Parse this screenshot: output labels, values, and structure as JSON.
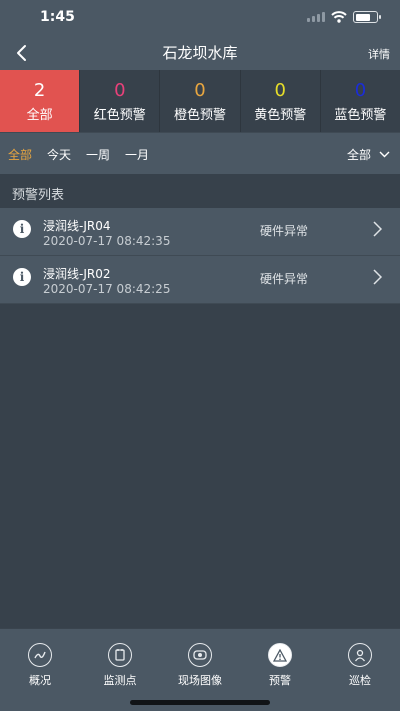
{
  "status_bar": {
    "time": "1:45"
  },
  "nav": {
    "title": "石龙坝水库",
    "detail": "详情"
  },
  "counters": [
    {
      "value": "2",
      "label": "全部",
      "color": "#ffffff"
    },
    {
      "value": "0",
      "label": "红色预警",
      "color": "#e8417a"
    },
    {
      "value": "0",
      "label": "橙色预警",
      "color": "#e8a640"
    },
    {
      "value": "0",
      "label": "黄色预警",
      "color": "#e6dd2a"
    },
    {
      "value": "0",
      "label": "蓝色预警",
      "color": "#1b2dd8"
    }
  ],
  "filters": {
    "tabs": [
      "全部",
      "今天",
      "一周",
      "一月"
    ],
    "select": "全部"
  },
  "section": {
    "title": "预警列表"
  },
  "alerts": [
    {
      "name": "浸润线-JR04",
      "time": "2020-07-17 08:42:35",
      "status": "硬件异常"
    },
    {
      "name": "浸润线-JR02",
      "time": "2020-07-17 08:42:25",
      "status": "硬件异常"
    }
  ],
  "tabbar": [
    {
      "label": "概况",
      "icon": "overview-icon"
    },
    {
      "label": "监测点",
      "icon": "monitor-point-icon"
    },
    {
      "label": "现场图像",
      "icon": "camera-icon"
    },
    {
      "label": "预警",
      "icon": "warning-icon"
    },
    {
      "label": "巡检",
      "icon": "inspection-icon"
    }
  ],
  "colors": {
    "accent_active_counter": "#e15350",
    "active_filter": "#e8a640"
  }
}
